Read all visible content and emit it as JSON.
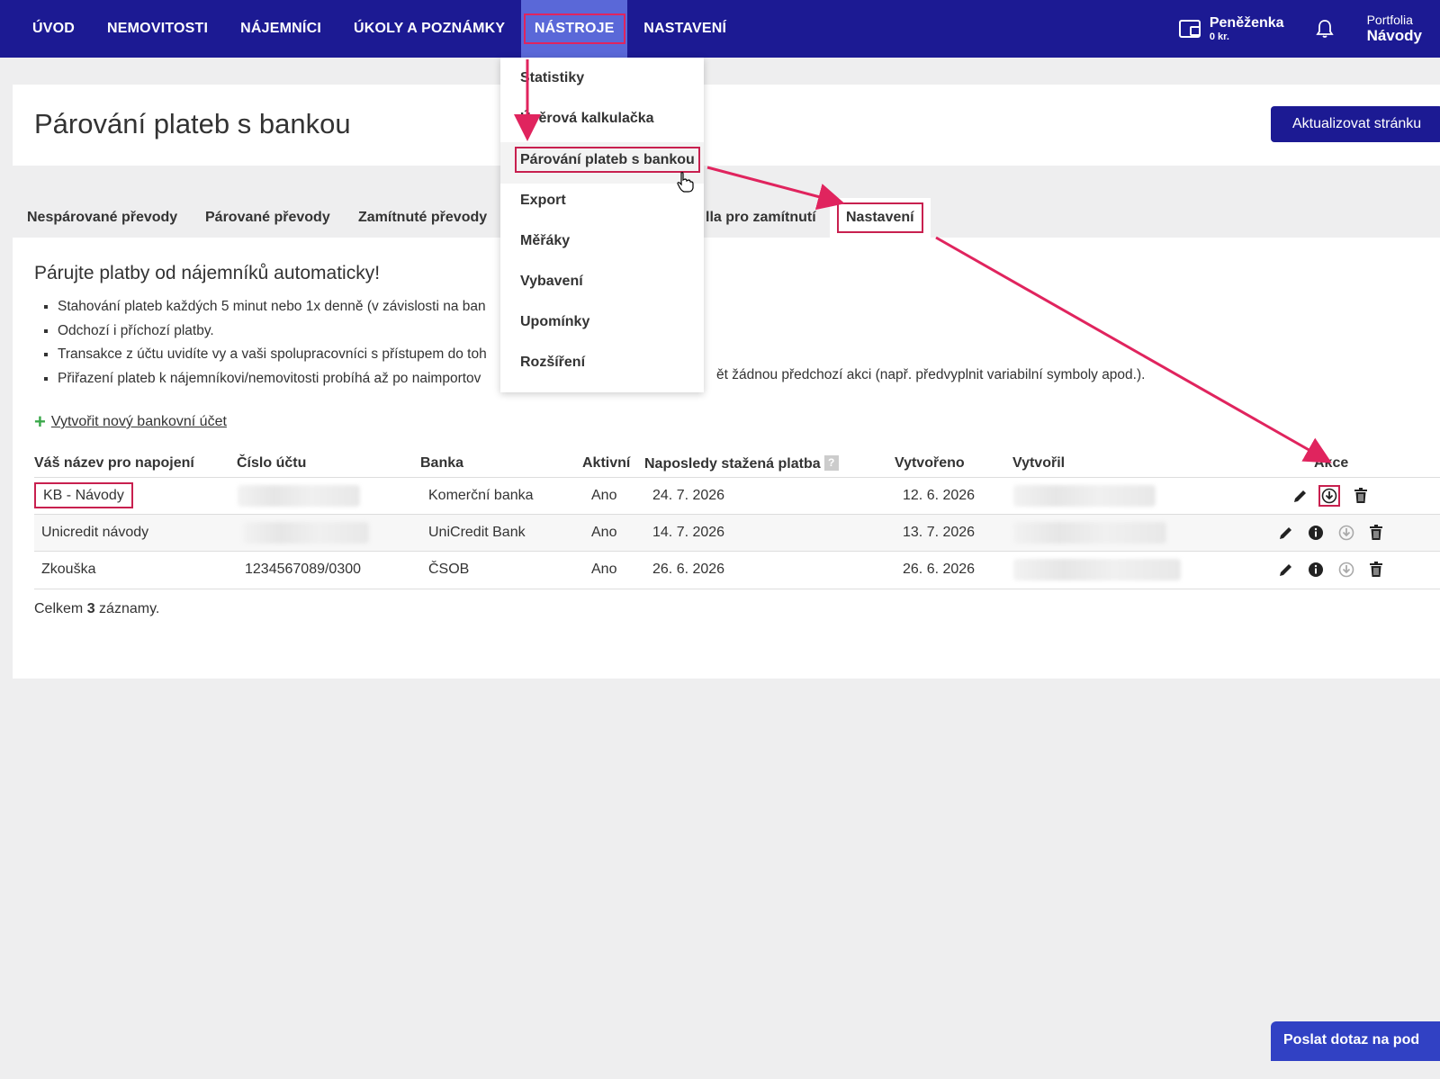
{
  "nav": {
    "items": [
      "ÚVOD",
      "NEMOVITOSTI",
      "NÁJEMNÍCI",
      "ÚKOLY A POZNÁMKY",
      "NÁSTROJE",
      "NASTAVENÍ"
    ],
    "active": "NÁSTROJE",
    "wallet_label": "Peněženka",
    "wallet_amount": "0 kr.",
    "portfolio_label": "Portfolia",
    "portfolio_name": "Návody"
  },
  "header": {
    "title": "Párování plateb s bankou",
    "refresh_button": "Aktualizovat stránku"
  },
  "tabs": [
    "Nespárované převody",
    "Párované převody",
    "Zamítnuté převody",
    "lla pro zamítnutí",
    "Nastavení"
  ],
  "intro": {
    "title": "Párujte platby od nájemníků automaticky!",
    "bullets": [
      "Stahování plateb každých 5 minut nebo 1x denně (v závislosti na ban",
      "Odchozí i příchozí platby.",
      "Transakce z účtu uvidíte vy a vaši spolupracovníci s přístupem do toh",
      "Přiřazení plateb k nájemníkovi/nemovitosti probíhá až po naimportov"
    ],
    "bullet4_tail": "ět žádnou předchozí akci (např. předvyplnit variabilní symboly apod.).",
    "create_link": "Vytvořit nový bankovní účet"
  },
  "table": {
    "headers": {
      "name": "Váš název pro napojení",
      "account": "Číslo účtu",
      "bank": "Banka",
      "active": "Aktivní",
      "last": "Naposledy stažená platba",
      "help": "?",
      "created": "Vytvořeno",
      "creator": "Vytvořil",
      "actions": "Akce"
    },
    "rows": [
      {
        "name": "KB - Návody",
        "account": "",
        "bank": "Komerční banka",
        "active": "Ano",
        "last": "24. 7. 2026",
        "created": "12. 6. 2026"
      },
      {
        "name": "Unicredit návody",
        "account": "",
        "bank": "UniCredit Bank",
        "active": "Ano",
        "last": "14. 7. 2026",
        "created": "13. 7. 2026"
      },
      {
        "name": "Zkouška",
        "account": "1234567089/0300",
        "bank": "ČSOB",
        "active": "Ano",
        "last": "26. 6. 2026",
        "created": "26. 6. 2026"
      }
    ],
    "summary_prefix": "Celkem",
    "summary_count": "3",
    "summary_suffix": "záznamy."
  },
  "dropdown": {
    "items": [
      "Statistiky",
      "Úvěrová kalkulačka",
      "Párování plateb s bankou",
      "Export",
      "Měřáky",
      "Vybavení",
      "Upomínky",
      "Rozšíření"
    ]
  },
  "support_button": "Poslat dotaz na pod",
  "colors": {
    "nav_bg": "#1c1a93",
    "nav_active": "#5a68d8",
    "highlight": "#e0245e",
    "primary_button": "#1c1a93",
    "support_button": "#3141c4"
  }
}
